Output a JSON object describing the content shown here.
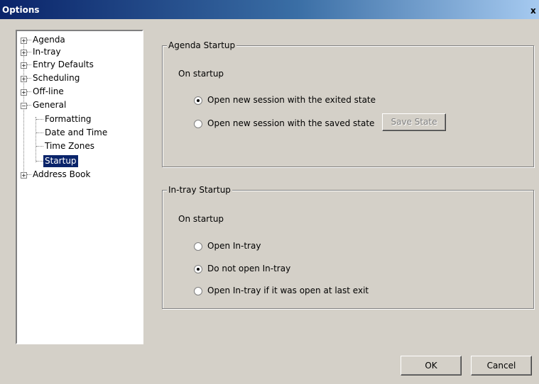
{
  "window": {
    "title": "Options",
    "close_label": "x"
  },
  "tree": {
    "items": [
      {
        "label": "Agenda",
        "expander": "+"
      },
      {
        "label": "In-tray",
        "expander": "+"
      },
      {
        "label": "Entry Defaults",
        "expander": "+"
      },
      {
        "label": "Scheduling",
        "expander": "+"
      },
      {
        "label": "Off-line",
        "expander": "+"
      },
      {
        "label": "General",
        "expander": "−"
      },
      {
        "label": "Formatting"
      },
      {
        "label": "Date and Time"
      },
      {
        "label": "Time Zones"
      },
      {
        "label": "Startup",
        "selected": true
      },
      {
        "label": "Address Book",
        "expander": "+"
      }
    ]
  },
  "agenda_startup": {
    "title": "Agenda Startup",
    "on_startup_label": "On startup",
    "options": [
      {
        "label": "Open new session with the exited state",
        "checked": true
      },
      {
        "label": "Open new session with the saved state",
        "checked": false
      }
    ],
    "save_state_label": "Save State"
  },
  "intray_startup": {
    "title": "In-tray Startup",
    "on_startup_label": "On startup",
    "options": [
      {
        "label": "Open In-tray",
        "checked": false
      },
      {
        "label": "Do not open In-tray",
        "checked": true
      },
      {
        "label": "Open In-tray if it was open at last exit",
        "checked": false
      }
    ]
  },
  "buttons": {
    "ok_label": "OK",
    "cancel_label": "Cancel"
  },
  "colors": {
    "selection": "#0a246a",
    "dialog_bg": "#d4d0c8",
    "titlebar": "#0a246a"
  }
}
